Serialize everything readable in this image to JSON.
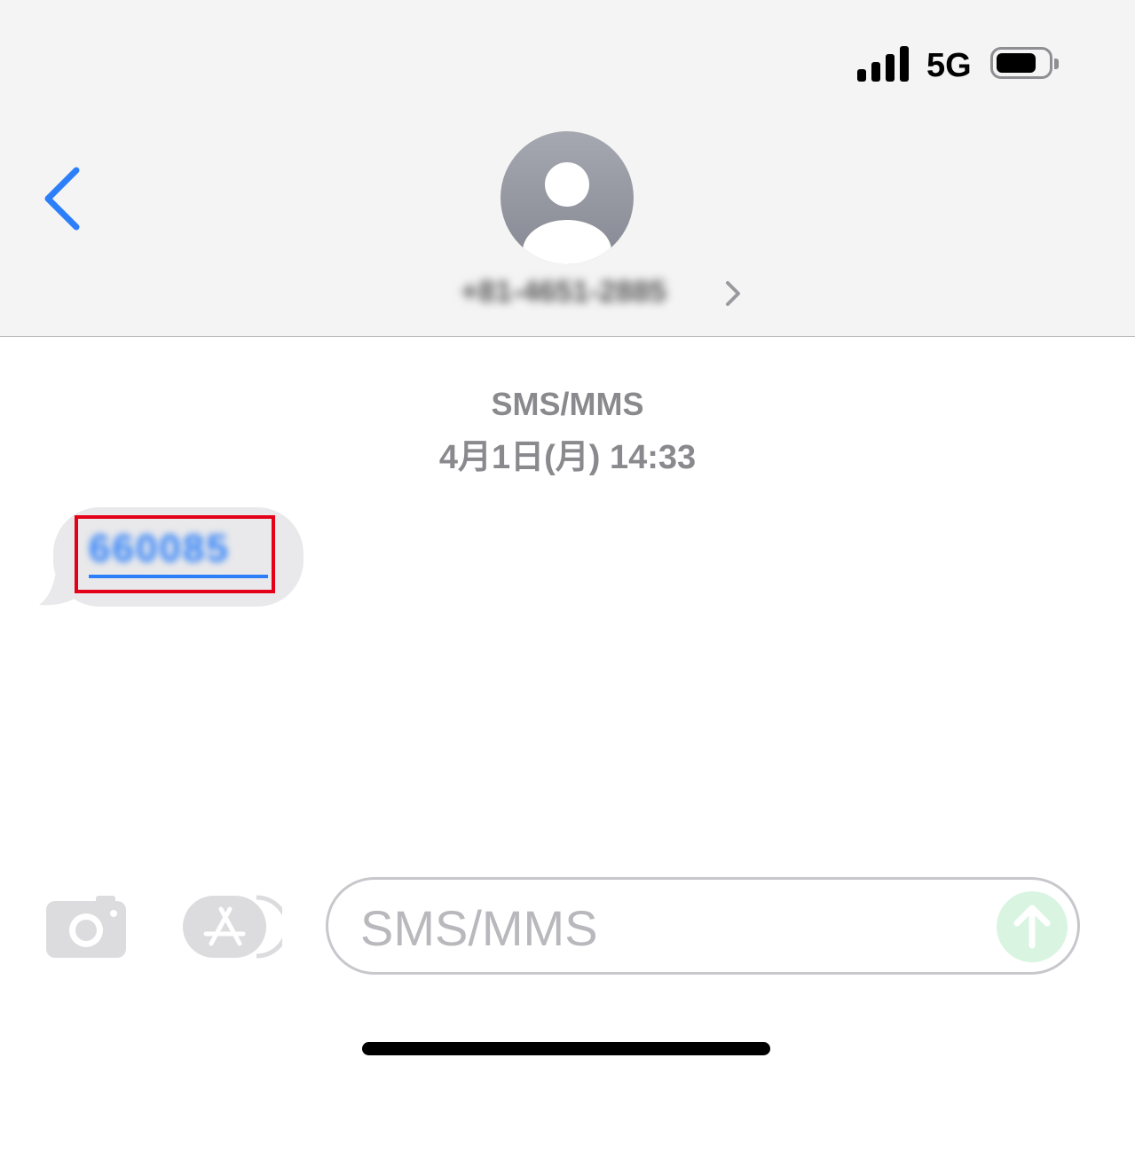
{
  "status_bar": {
    "network": "5G",
    "signal_bars": 4,
    "battery_level": 0.75
  },
  "header": {
    "back_icon": "chevron-left-icon",
    "avatar_icon": "person-icon",
    "contact_name": "+81-4651-2885",
    "contact_chevron_icon": "chevron-right-icon"
  },
  "conversation": {
    "service": "SMS/MMS",
    "date": "4月1日(月) 14:33",
    "messages": [
      {
        "direction": "incoming",
        "text": "660085",
        "is_link": true,
        "highlighted": true
      }
    ]
  },
  "composer": {
    "camera_icon": "camera-icon",
    "apps_icon": "app-store-icon",
    "placeholder": "SMS/MMS",
    "value": "",
    "send_icon": "arrow-up-icon"
  },
  "colors": {
    "accent": "#2d7ff9",
    "bubble_gray": "#e9e9eb",
    "highlight_red": "#e5001a",
    "send_green": "#d9f5e1"
  }
}
